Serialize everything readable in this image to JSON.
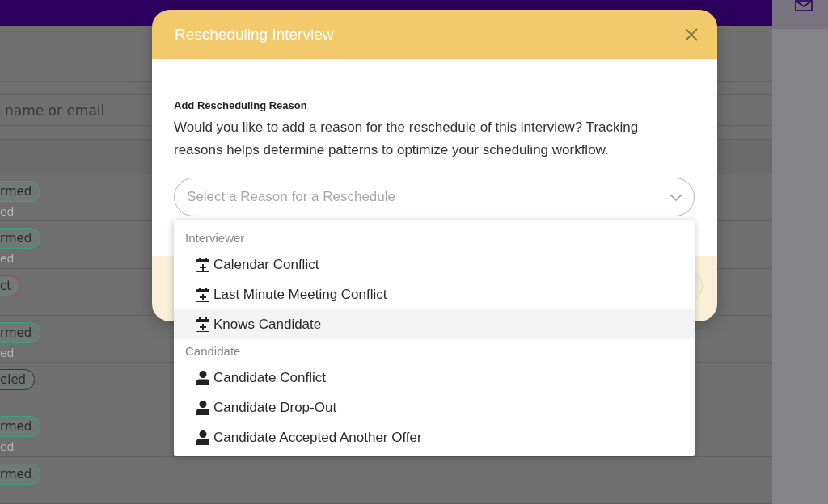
{
  "background": {
    "search": {
      "placeholder": "name or email"
    },
    "rows": [
      {
        "status": "rmed",
        "note": "ed",
        "color": "#3aa17f"
      },
      {
        "status": "rmed",
        "note": "ed",
        "color": "#3aa17f"
      },
      {
        "status": "ct",
        "color": "#c0394a"
      },
      {
        "status": "rmed",
        "note": "ed",
        "color": "#3aa17f"
      },
      {
        "status": "eled",
        "color": "#3c3c3c"
      },
      {
        "status": "rmed",
        "note": "ed",
        "color": "#3aa17f"
      },
      {
        "status": "rmed",
        "color": "#3aa17f"
      }
    ]
  },
  "modal": {
    "title": "Rescheduling Interview",
    "section_label": "Add Rescheduling Reason",
    "description": "Would you like to add a reason for the reschedule of this interview? Tracking reasons helps determine patterns to optimize your scheduling workflow.",
    "select": {
      "placeholder": "Select a Reason for a Reschedule"
    },
    "menu": {
      "groups": [
        {
          "label": "Interviewer",
          "kind": "calendar",
          "items": [
            {
              "label": "Calendar Conflict",
              "highlighted": false
            },
            {
              "label": "Last Minute Meeting Conflict",
              "highlighted": false
            },
            {
              "label": "Knows Candidate",
              "highlighted": true
            }
          ]
        },
        {
          "label": "Candidate",
          "kind": "person",
          "items": [
            {
              "label": "Candidate Conflict",
              "highlighted": false
            },
            {
              "label": "Candidate Drop-Out",
              "highlighted": false
            },
            {
              "label": "Candidate Accepted Another Offer",
              "highlighted": false
            }
          ]
        }
      ]
    }
  }
}
